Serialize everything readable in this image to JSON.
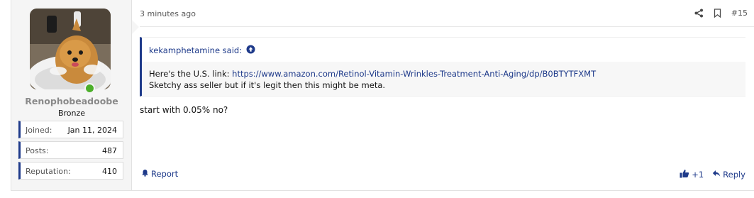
{
  "user": {
    "username": "Renophobeadoobe",
    "title": "Bronze",
    "online": true,
    "stats": [
      {
        "label": "Joined:",
        "value": "Jan 11, 2024"
      },
      {
        "label": "Posts:",
        "value": "487"
      },
      {
        "label": "Reputation:",
        "value": "410"
      }
    ]
  },
  "post": {
    "time": "3 minutes ago",
    "number": "#15",
    "quote": {
      "author": "kekamphetamine said:",
      "line1_prefix": "Here's the U.S. link: ",
      "link": "https://www.amazon.com/Retinol-Vitamin-Wrinkles-Treatment-Anti-Aging/dp/B0BTYTFXMT",
      "line2": "Sketchy ass seller but if it's legit then this might be meta."
    },
    "message": "start with 0.05% no?",
    "footer": {
      "report": "Report",
      "reaction_count": "+1",
      "reply": "Reply"
    }
  },
  "colors": {
    "accent": "#1e3a8a",
    "online": "#4caf2a",
    "sidebar_bg": "#f5f5f5"
  },
  "icons": [
    "share-icon",
    "bookmark-icon",
    "quote-arrow-up-icon",
    "bell-icon",
    "thumbs-up-icon",
    "reply-icon"
  ]
}
